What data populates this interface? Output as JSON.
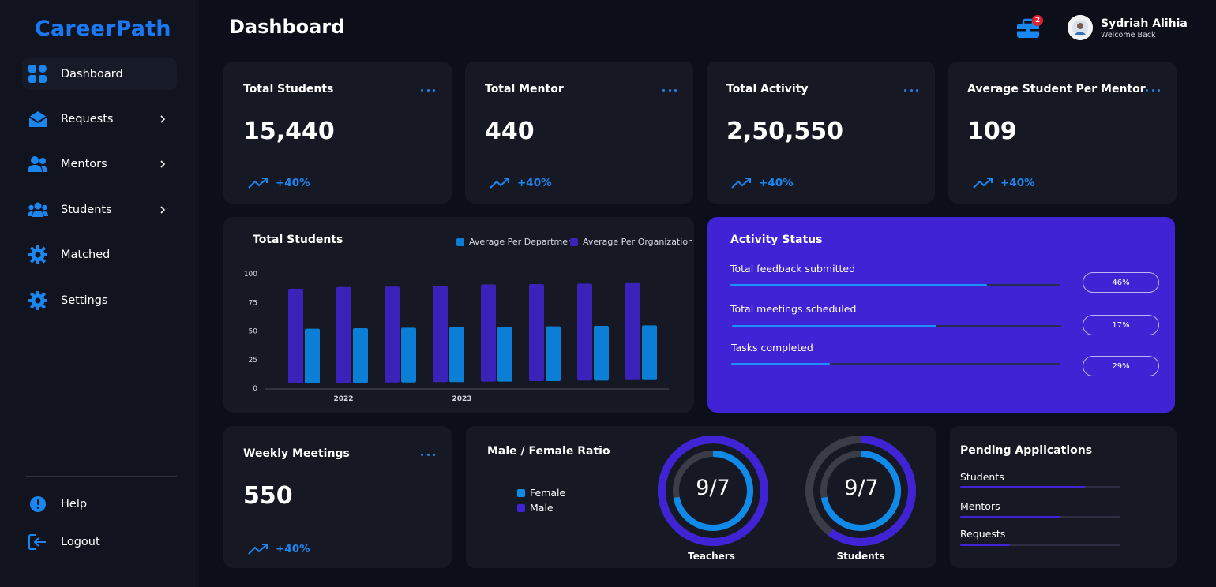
{
  "app": {
    "logo": "CareerPath"
  },
  "sidebar": {
    "items": [
      {
        "label": "Dashboard",
        "icon": "grid-icon",
        "active": true
      },
      {
        "label": "Requests",
        "icon": "mail-icon",
        "chevron": true
      },
      {
        "label": "Mentors",
        "icon": "users-icon",
        "chevron": true
      },
      {
        "label": "Students",
        "icon": "group-icon",
        "chevron": true
      },
      {
        "label": "Matched",
        "icon": "gear-icon"
      },
      {
        "label": "Settings",
        "icon": "gear-icon"
      }
    ],
    "bottom": [
      {
        "label": "Help",
        "icon": "info-icon"
      },
      {
        "label": "Logout",
        "icon": "logout-icon"
      }
    ]
  },
  "header": {
    "title": "Dashboard",
    "notification_count": "2",
    "user_name": "Sydriah Alihia",
    "user_subtitle": "Welcome Back"
  },
  "stats": [
    {
      "title": "Total Students",
      "value": "15,440",
      "trend": "+40%"
    },
    {
      "title": "Total Mentor",
      "value": "440",
      "trend": "+40%"
    },
    {
      "title": "Total Activity",
      "value": "2,50,550",
      "trend": "+40%"
    },
    {
      "title": "Average Student Per Mentor",
      "value": "109",
      "trend": "+40%"
    }
  ],
  "chart_data": {
    "type": "bar",
    "title": "Total Students",
    "legend_position": "top-right",
    "ylim": [
      0,
      100
    ],
    "yticks": [
      "100",
      "75",
      "50",
      "25",
      "0"
    ],
    "xtick_labels": [
      "2022",
      "2023"
    ],
    "categories": [
      "",
      "",
      "",
      "",
      "",
      "",
      "",
      ""
    ],
    "series": [
      {
        "name": "Average Per Organization",
        "color": "#3b22b8",
        "values": [
          87,
          88,
          88,
          88,
          89,
          89,
          89,
          89
        ]
      },
      {
        "name": "Average Per Department",
        "color": "#0b7fd6",
        "values": [
          52,
          52,
          52,
          52,
          52,
          52,
          52,
          52
        ]
      }
    ]
  },
  "activity": {
    "title": "Activity Status",
    "rows": [
      {
        "label": "Total feedback submitted",
        "pill": "46%",
        "fill": 0.78
      },
      {
        "label": "Total meetings scheduled",
        "pill": "17%",
        "fill": 0.62
      },
      {
        "label": "Tasks completed",
        "pill": "29%",
        "fill": 0.3
      }
    ]
  },
  "weekly": {
    "title": "Weekly Meetings",
    "value": "550",
    "trend": "+40%"
  },
  "ratio": {
    "title": "Male / Female Ratio",
    "legend": [
      {
        "label": "Female",
        "color": "#0f8ae8"
      },
      {
        "label": "Male",
        "color": "#3f23d4"
      }
    ],
    "rings": [
      {
        "label": "Teachers",
        "value": "9/7",
        "outer": 1.0,
        "inner": 0.72
      },
      {
        "label": "Students",
        "value": "9/7",
        "outer": 0.6,
        "inner": 0.72
      }
    ]
  },
  "pending": {
    "title": "Pending Applications",
    "rows": [
      {
        "label": "Students",
        "fill": 0.78
      },
      {
        "label": "Mentors",
        "fill": 0.63
      },
      {
        "label": "Requests",
        "fill": 0.31
      }
    ]
  },
  "colors": {
    "accent": "#1a86f0",
    "purple": "#3f23d4",
    "card": "#161924",
    "bg": "#0c0f19"
  }
}
